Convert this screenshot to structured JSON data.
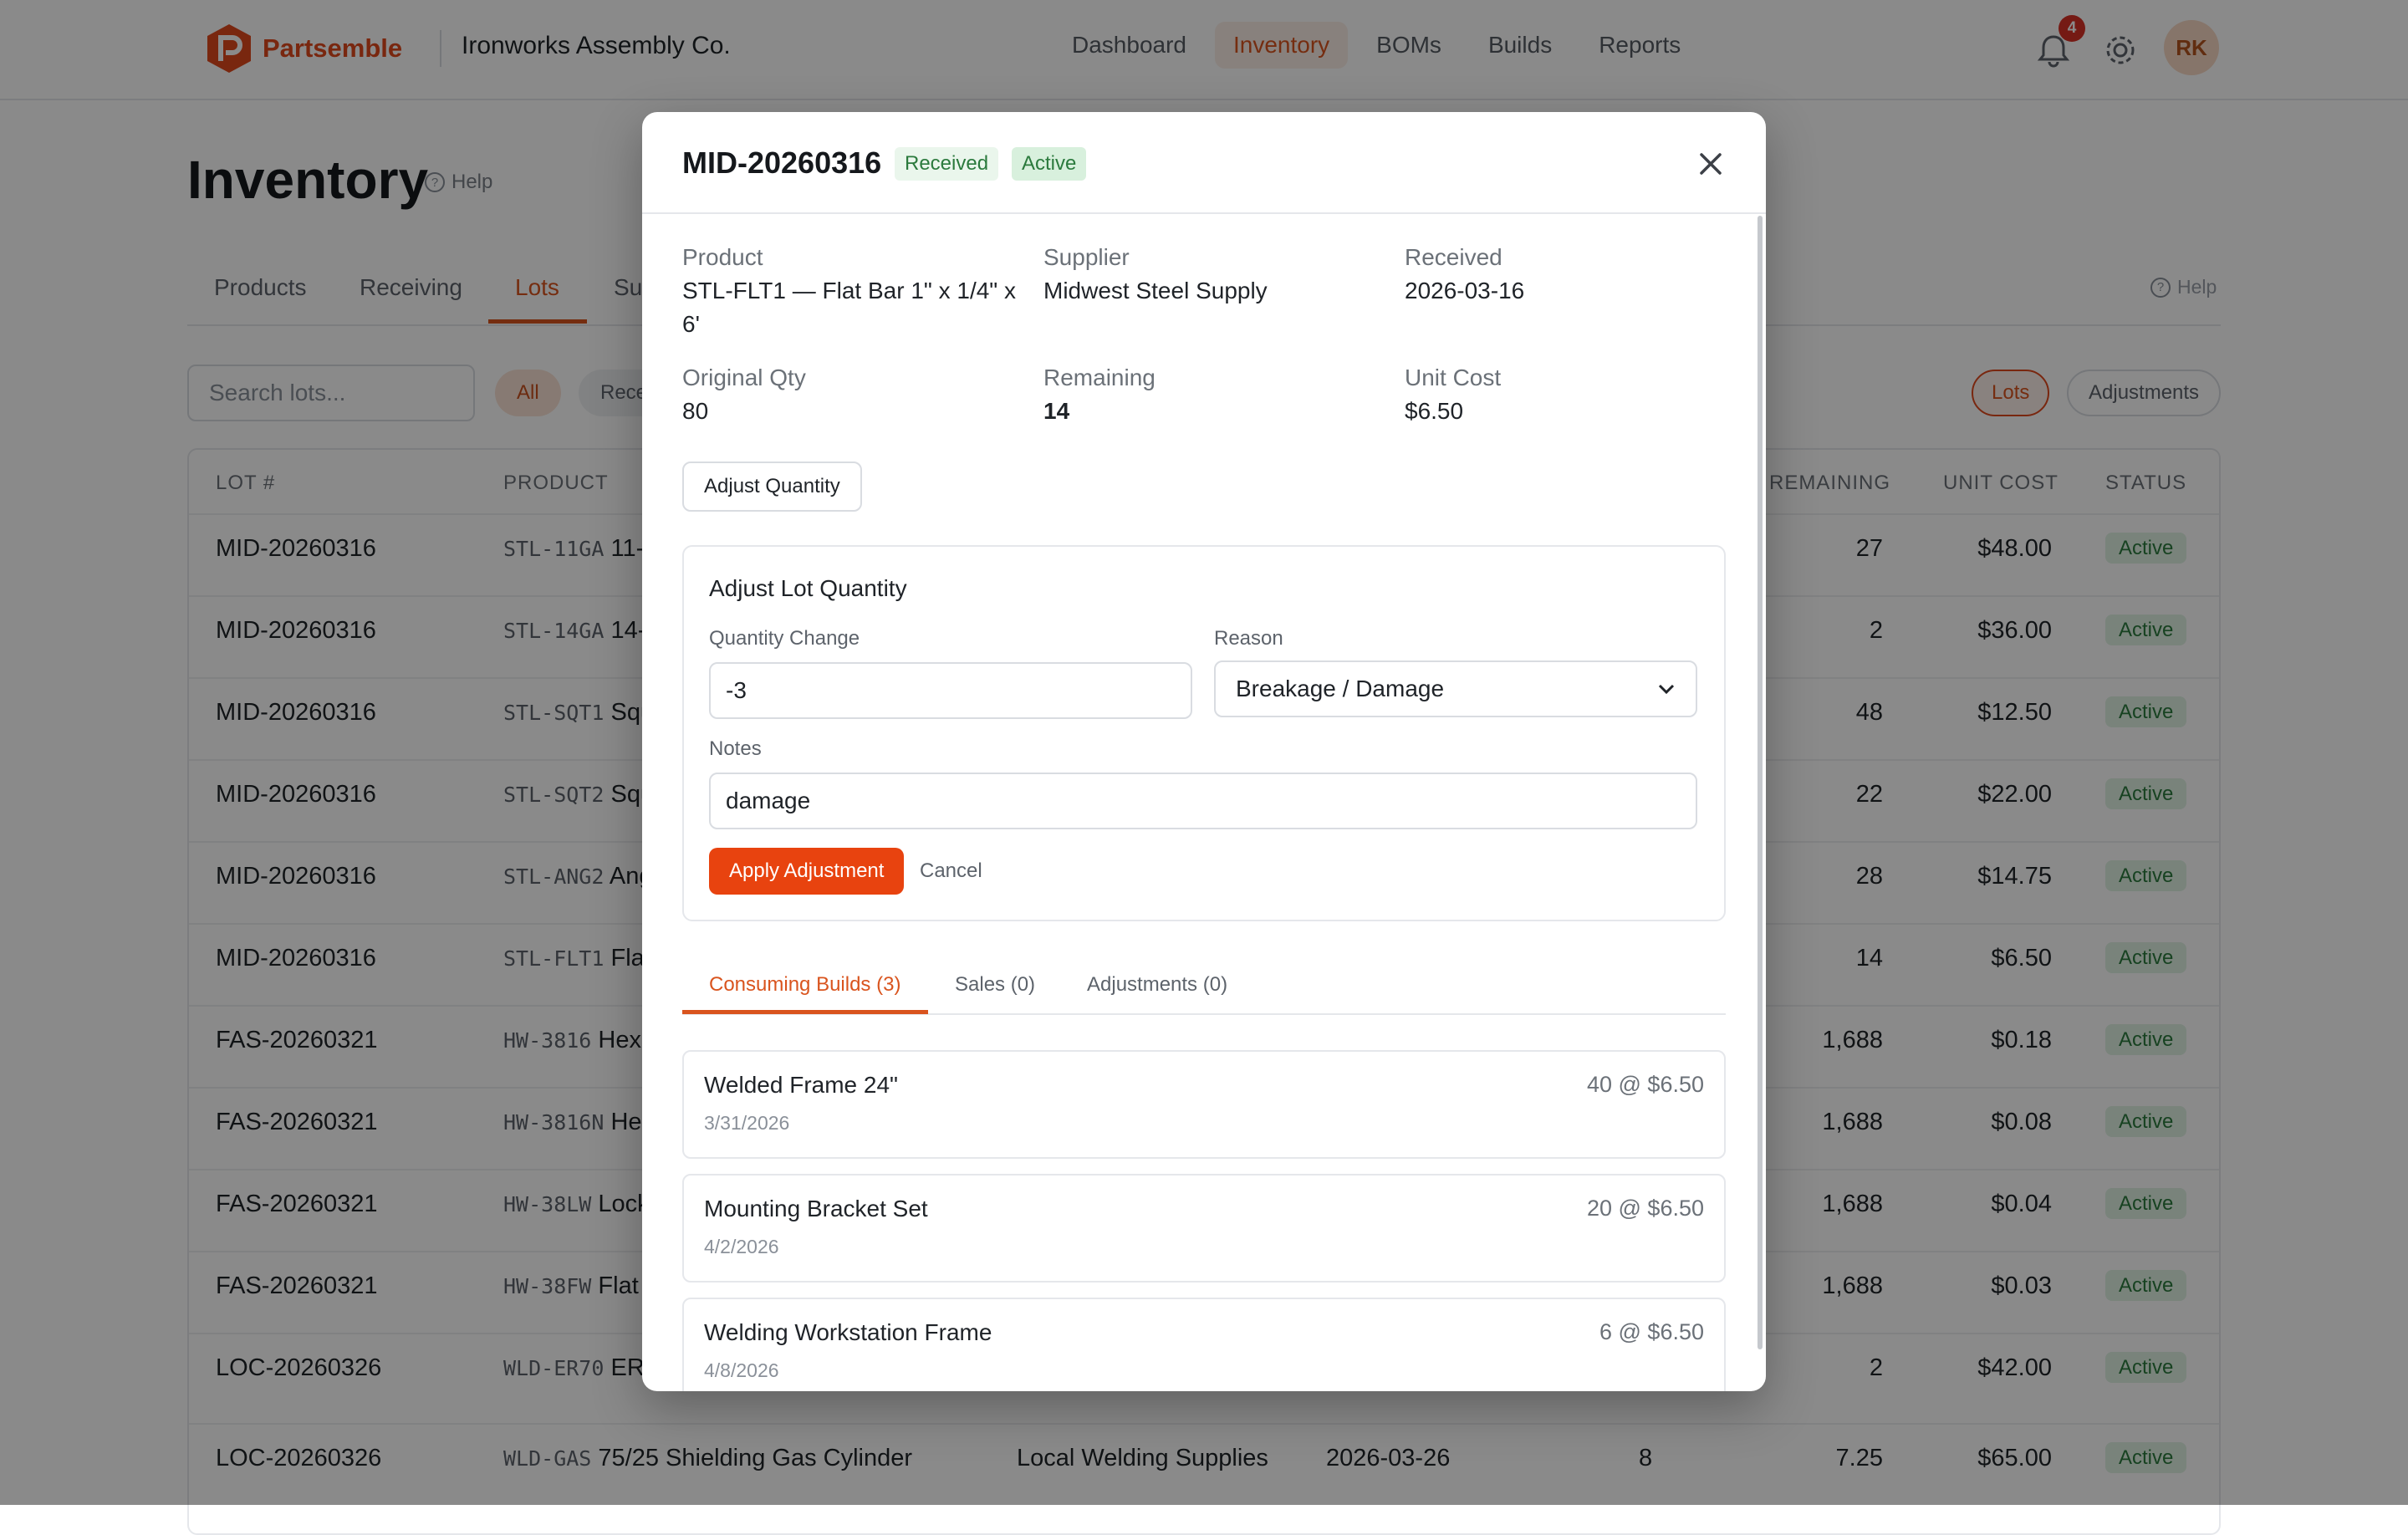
{
  "brand": {
    "name": "Partsemble",
    "company": "Ironworks Assembly Co.",
    "accent": "#e0481c"
  },
  "nav": {
    "links": [
      "Dashboard",
      "Inventory",
      "BOMs",
      "Builds",
      "Reports"
    ],
    "notification_count": "4",
    "avatar_initials": "RK"
  },
  "page": {
    "title": "Inventory",
    "help_label": "Help",
    "tabs": [
      "Products",
      "Receiving",
      "Lots",
      "Su"
    ],
    "tabs_help": "Help",
    "search_placeholder": "Search lots...",
    "filter_all": "All",
    "filter_received": "Rece",
    "toggle_lots": "Lots",
    "toggle_adjustments": "Adjustments"
  },
  "table": {
    "headers": {
      "lot": "LOT #",
      "product": "PRODUCT",
      "remaining": "REMAINING",
      "unit_cost": "UNIT COST",
      "status": "STATUS"
    },
    "rows": [
      {
        "lot": "MID-20260316",
        "sku": "STL-11GA",
        "name": "11-",
        "remaining": "27",
        "cost": "$48.00",
        "status": "Active"
      },
      {
        "lot": "MID-20260316",
        "sku": "STL-14GA",
        "name": "14-",
        "remaining": "2",
        "cost": "$36.00",
        "status": "Active"
      },
      {
        "lot": "MID-20260316",
        "sku": "STL-SQT1",
        "name": "Squ",
        "remaining": "48",
        "cost": "$12.50",
        "status": "Active"
      },
      {
        "lot": "MID-20260316",
        "sku": "STL-SQT2",
        "name": "Squ",
        "remaining": "22",
        "cost": "$22.00",
        "status": "Active"
      },
      {
        "lot": "MID-20260316",
        "sku": "STL-ANG2",
        "name": "Ang",
        "remaining": "28",
        "cost": "$14.75",
        "status": "Active"
      },
      {
        "lot": "MID-20260316",
        "sku": "STL-FLT1",
        "name": "Fla",
        "remaining": "14",
        "cost": "$6.50",
        "status": "Active"
      },
      {
        "lot": "FAS-20260321",
        "sku": "HW-3816",
        "name": "Hex",
        "remaining": "1,688",
        "cost": "$0.18",
        "status": "Active"
      },
      {
        "lot": "FAS-20260321",
        "sku": "HW-3816N",
        "name": "Hex",
        "remaining": "1,688",
        "cost": "$0.08",
        "status": "Active"
      },
      {
        "lot": "FAS-20260321",
        "sku": "HW-38LW",
        "name": "Lock",
        "remaining": "1,688",
        "cost": "$0.04",
        "status": "Active"
      },
      {
        "lot": "FAS-20260321",
        "sku": "HW-38FW",
        "name": "Flat",
        "remaining": "1,688",
        "cost": "$0.03",
        "status": "Active"
      },
      {
        "lot": "LOC-20260326",
        "sku": "WLD-ER70",
        "name": "ER",
        "remaining": "2",
        "cost": "$42.00",
        "status": "Active"
      }
    ],
    "last_row": {
      "lot": "LOC-20260326",
      "sku": "WLD-GAS",
      "name": "75/25 Shielding Gas Cylinder",
      "supplier": "Local Welding Supplies",
      "received": "2026-03-26",
      "qty": "8",
      "remaining": "7.25",
      "cost": "$65.00",
      "status": "Active"
    }
  },
  "modal": {
    "title": "MID-20260316",
    "badge_received": "Received",
    "badge_active": "Active",
    "fields": {
      "product_label": "Product",
      "product_value": "STL-FLT1 — Flat Bar 1\" x 1/4\" x 6'",
      "supplier_label": "Supplier",
      "supplier_value": "Midwest Steel Supply",
      "received_label": "Received",
      "received_value": "2026-03-16",
      "orig_label": "Original Qty",
      "orig_value": "80",
      "remaining_label": "Remaining",
      "remaining_value": "14",
      "cost_label": "Unit Cost",
      "cost_value": "$6.50"
    },
    "adjust_button": "Adjust Quantity",
    "adjust": {
      "title": "Adjust Lot Quantity",
      "qty_label": "Quantity Change",
      "qty_value": "-3",
      "reason_label": "Reason",
      "reason_value": "Breakage / Damage",
      "notes_label": "Notes",
      "notes_value": "damage",
      "apply_label": "Apply Adjustment",
      "cancel_label": "Cancel"
    },
    "subtabs": [
      "Consuming Builds (3)",
      "Sales (0)",
      "Adjustments (0)"
    ],
    "builds": [
      {
        "name": "Welded Frame 24\"",
        "date": "3/31/2026",
        "qty": "40 @ $6.50"
      },
      {
        "name": "Mounting Bracket Set",
        "date": "4/2/2026",
        "qty": "20 @ $6.50"
      },
      {
        "name": "Welding Workstation Frame",
        "date": "4/8/2026",
        "qty": "6 @ $6.50"
      }
    ]
  }
}
